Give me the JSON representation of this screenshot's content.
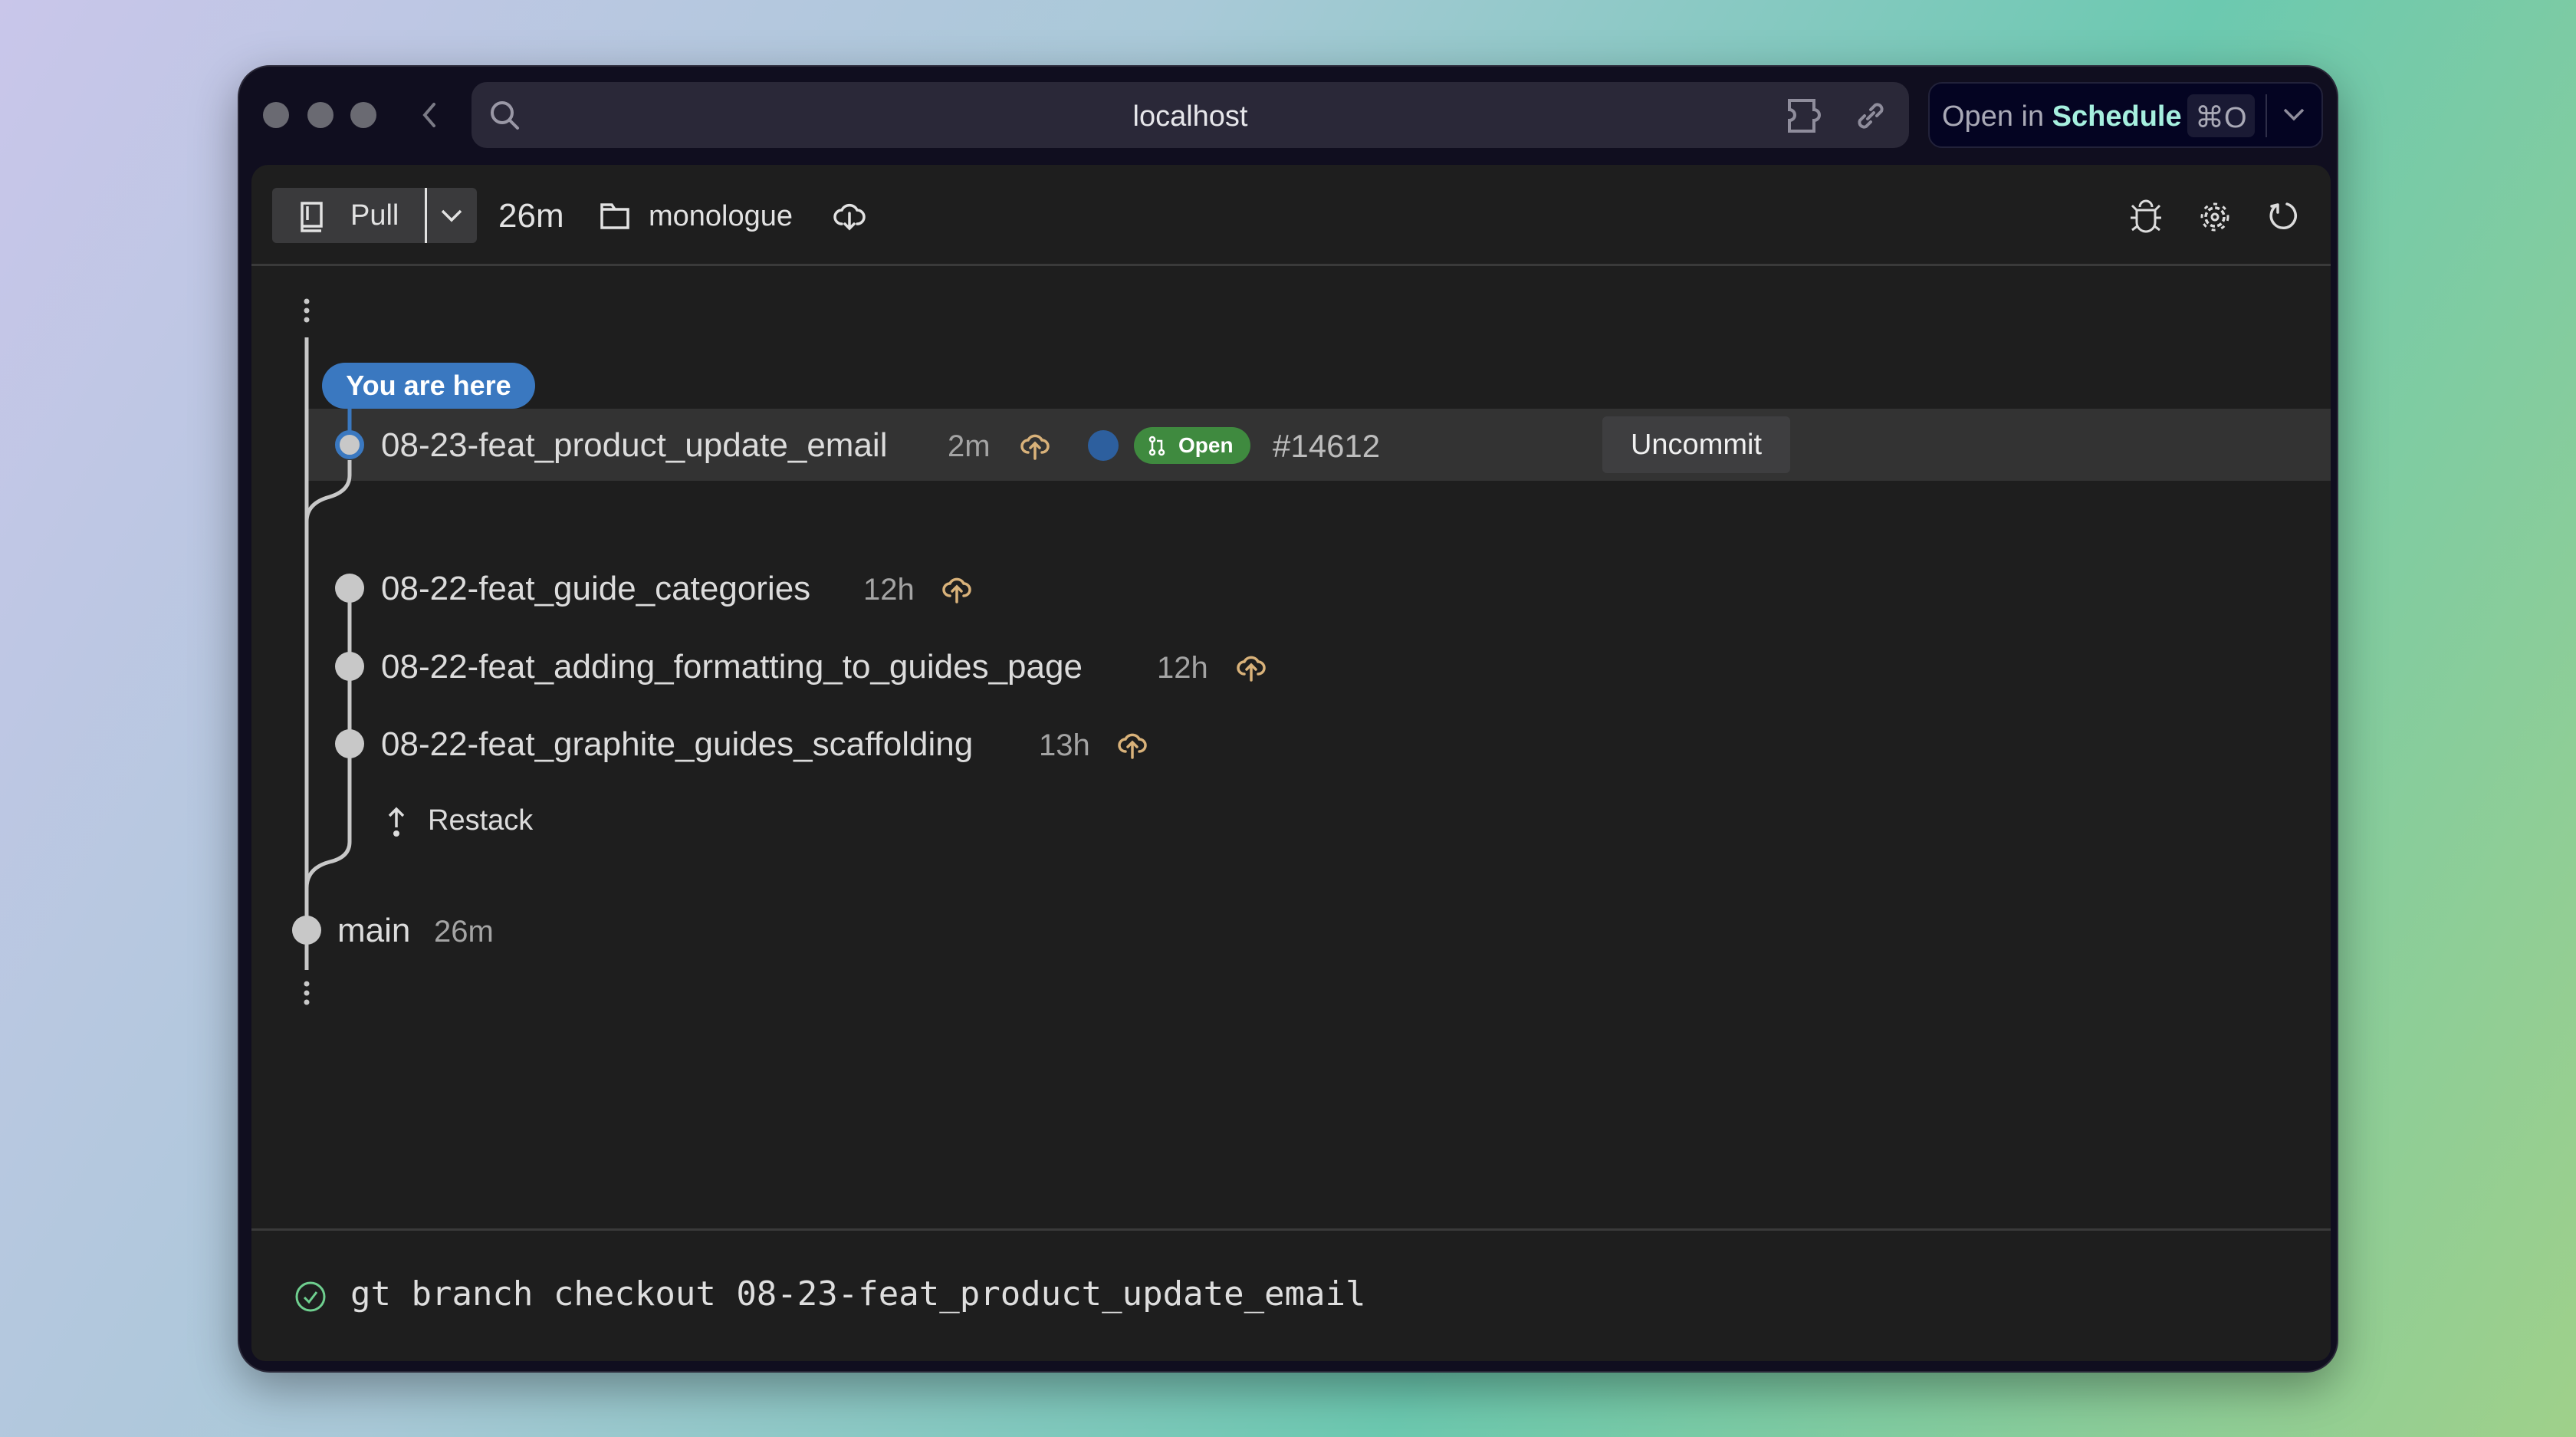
{
  "browser": {
    "url": "localhost",
    "open_in_prefix": "Open in",
    "open_in_app": "Schedule",
    "shortcut": "⌘O"
  },
  "toolbar": {
    "pull_label": "Pull",
    "age": "26m",
    "repo": "monologue"
  },
  "colors": {
    "accent": "#3a78c0",
    "open_badge": "#3f8a3f",
    "schedule": "#a6f0df",
    "sync_icon": "#d9b27a",
    "success": "#6fcf8f"
  },
  "graph": {
    "you_are_here": "You are here",
    "current": {
      "name": "08-23-feat_product_update_email",
      "age": "2m",
      "pr_status": "Open",
      "pr_number": "#14612",
      "action": "Uncommit"
    },
    "branches": [
      {
        "name": "08-22-feat_guide_categories",
        "age": "12h"
      },
      {
        "name": "08-22-feat_adding_formatting_to_guides_page",
        "age": "12h"
      },
      {
        "name": "08-22-feat_graphite_guides_scaffolding",
        "age": "13h"
      }
    ],
    "restack_label": "Restack",
    "trunk": {
      "name": "main",
      "age": "26m"
    }
  },
  "console": {
    "command": "gt branch checkout 08-23-feat_product_update_email"
  }
}
